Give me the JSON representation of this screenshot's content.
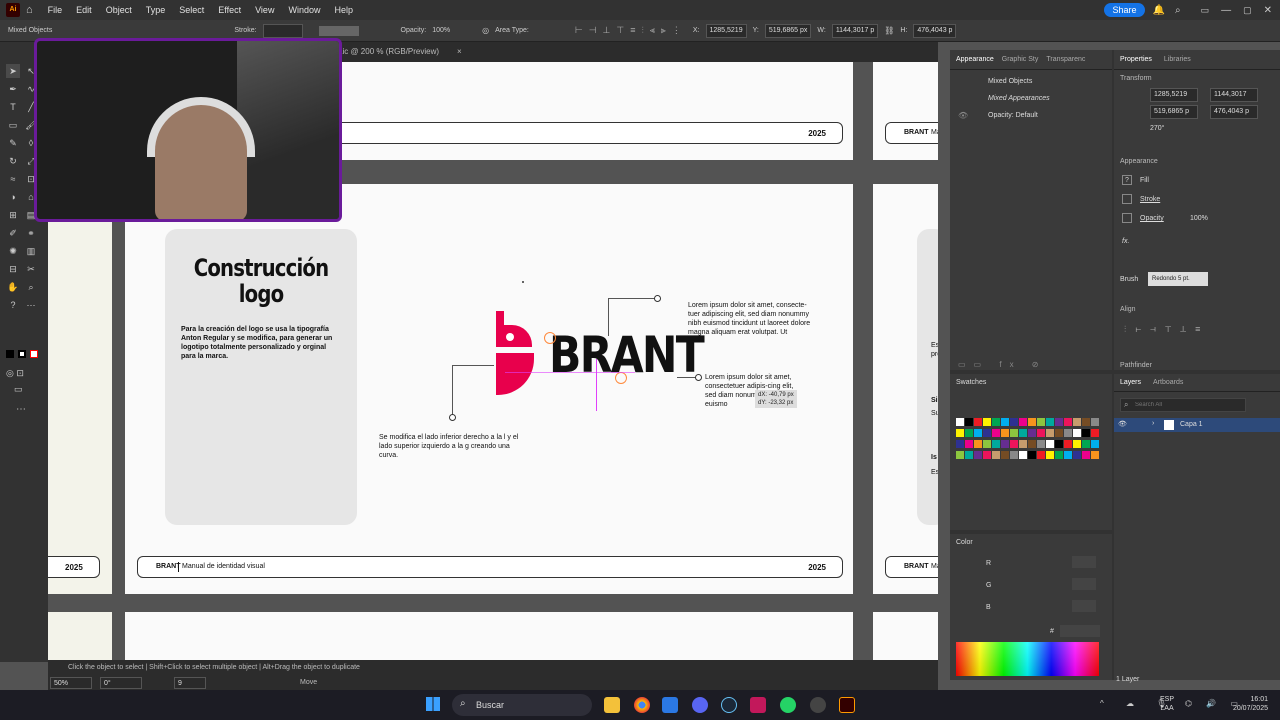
{
  "menubar": {
    "app_icon": "Ai",
    "items": [
      "File",
      "Edit",
      "Object",
      "Type",
      "Select",
      "Effect",
      "View",
      "Window",
      "Help"
    ],
    "share_label": "Share"
  },
  "control_bar": {
    "selection": "Mixed Objects",
    "stroke_label": "Stroke:",
    "opacity_label": "Opacity:",
    "opacity_value": "100%",
    "area_type_label": "Area Type:",
    "x_label": "X:",
    "x_value": "1285,5219",
    "y_label": "Y:",
    "y_value": "519,6865 px",
    "w_label": "W:",
    "w_value": "1144,3017 p",
    "h_label": "H:",
    "h_value": "476,4043 p"
  },
  "document_tab": {
    "title": "aic @ 200 % (RGB/Preview)",
    "close": "×"
  },
  "artboard": {
    "title_line1": "Construcción",
    "title_line2": "logo",
    "description": "Para la creación del logo se usa la tipografía Anton Regular y se modifica, para generar un logotipo totalmente personalizado y orginal para la marca.",
    "logo_text": "BRANT",
    "lorem1": "Lorem ipsum dolor sit amet, consecte-tuer adipiscing elit, sed diam nonummy nibh euismod tincidunt ut laoreet dolore magna aliquam erat volutpat. Ut",
    "lorem2": "Lorem ipsum dolor sit amet, consectetuer adipis-cing elit, sed diam nonummy nibh euismo",
    "note": "Se modifica el lado inferior derecho a la l y el lado superior izquierdo a la g creando una curva.",
    "dx": "dX: -40,79 px",
    "dy": "dY: -23,32 px",
    "footer_year": "2025",
    "footer_brand": "BRANT",
    "footer_manual": "Manual de identidad visual",
    "side_brand": "BRANT",
    "side_ma": "Ma",
    "side_texts": [
      "Es",
      "pro",
      "Su",
      "Si",
      "Su",
      "Es",
      "Is"
    ]
  },
  "appearance_panel": {
    "tabs": [
      "Appearance",
      "Graphic Sty",
      "Transparenc"
    ],
    "items": [
      "Mixed Objects",
      "Mixed Appearances",
      "Opacity: Default"
    ]
  },
  "properties_panel": {
    "tabs": [
      "Properties",
      "Libraries"
    ],
    "transform": "Transform",
    "x": "1285,5219",
    "y": "519,6865 p",
    "w": "1144,3017",
    "h": "476,4043 p",
    "angle": "270°",
    "appearance": "Appearance",
    "fill": "Fill",
    "stroke": "Stroke",
    "opacity": "Opacity",
    "opacity_value": "100%",
    "fx": "fx.",
    "brush_label": "Brush",
    "brush_value": "Redondo 5 pt.",
    "align": "Align",
    "pathfinder": "Pathfinder"
  },
  "swatches_panel": {
    "title": "Swatches"
  },
  "color_panel": {
    "title": "Color",
    "r": "R",
    "g": "G",
    "b": "B",
    "hash": "#"
  },
  "layers_panel": {
    "tabs": [
      "Layers",
      "Artboards"
    ],
    "layer_name": "Capa 1",
    "search_placeholder": "Search All",
    "footer": "1 Layer"
  },
  "status_bar": {
    "hint": "Click the object to select  |  Shift+Click to select multiple object  |  Alt+Drag the object to duplicate",
    "zoom": "50%",
    "rotation": "0°",
    "artboard_num": "9",
    "mode": "Move"
  },
  "taskbar": {
    "search": "Buscar",
    "lang1": "ESP",
    "lang2": "LAA",
    "time": "16:01",
    "date": "20/07/2025"
  },
  "colors": {
    "accent": "#e8004c",
    "ui_dark": "#323232",
    "canvas": "#535353",
    "webcam_border": "#6a1b9a",
    "share_blue": "#1473e6"
  }
}
